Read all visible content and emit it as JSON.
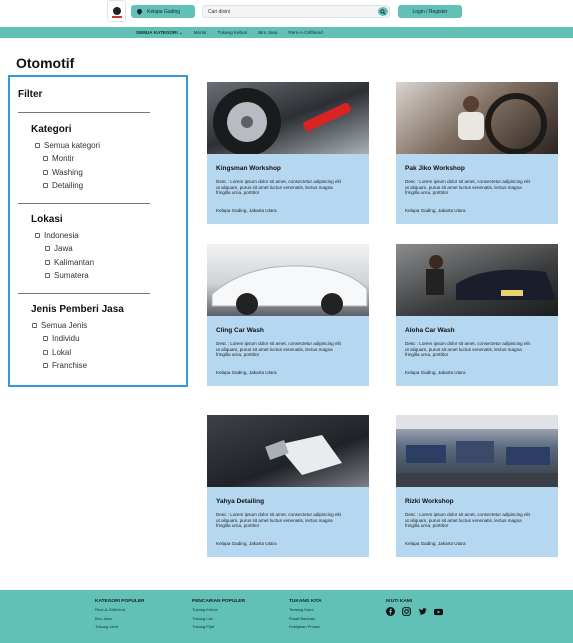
{
  "header": {
    "location_label": "Kelapa Gading",
    "search_placeholder": "Cari disini",
    "login_label": "Login / Register"
  },
  "nav": {
    "items": [
      "SEMUA KATEGORI ⌄",
      "Montir",
      "Tukang Kebun",
      "Biro Jasa",
      "Rent-A-Girlfriend"
    ]
  },
  "page": {
    "title": "Otomotif"
  },
  "filter": {
    "title": "Filter",
    "kategori": {
      "heading": "Kategori",
      "options": [
        "Semua kategori",
        "Montir",
        "Washing",
        "Detailing"
      ]
    },
    "lokasi": {
      "heading": "Lokasi",
      "options": [
        "Indonesia",
        "Jawa",
        "Kalimantan",
        "Sumatera"
      ]
    },
    "jenis": {
      "heading": "Jenis Pemberi Jasa",
      "options": [
        "Semua Jenis",
        "Individu",
        "Lokal",
        "Franchise"
      ]
    }
  },
  "cards": [
    {
      "name": "Kingsman Workshop",
      "desc": "Desc : Lorem ipsum dolor sit amet, consectetur adipiscing elit ut aliquam, purus sit amet luctus venenatis, lectus magna fringilla urna, porttitor",
      "location": "Kelapa Gading, Jakarta Utara"
    },
    {
      "name": "Pak Jiko Workshop",
      "desc": "Desc : Lorem ipsum dolor sit amet, consectetur adipiscing elit ut aliquam, purus sit amet luctus venenatis, lectus magna fringilla urna, porttitor",
      "location": "Kelapa Gading, Jakarta Utara"
    },
    {
      "name": "Cling Car Wash",
      "desc": "Desc : Lorem ipsum dolor sit amet, consectetur adipiscing elit ut aliquam, purus sit amet luctus venenatis, lectus magna fringilla urna, porttitor",
      "location": "Kelapa Gading, Jakarta Utara"
    },
    {
      "name": "Aloha Car Wash",
      "desc": "Desc : Lorem ipsum dolor sit amet, consectetur adipiscing elit ut aliquam, purus sit amet luctus venenatis, lectus magna fringilla urna, porttitor",
      "location": "Kelapa Gading, Jakarta Utara"
    },
    {
      "name": "Yahya Detailing",
      "desc": "Desc : Lorem ipsum dolor sit amet, consectetur adipiscing elit ut aliquam, purus sit amet luctus venenatis, lectus magna fringilla urna, porttitor",
      "location": "Kelapa Gading, Jakarta Utara"
    },
    {
      "name": "Rizki Workshop",
      "desc": "Desc : Lorem ipsum dolor sit amet, consectetur adipiscing elit ut aliquam, purus sit amet luctus venenatis, lectus magna fringilla urna, porttitor",
      "location": "Kelapa Gading, Jakarta Utara"
    }
  ],
  "footer": {
    "kategori_populer": {
      "heading": "KATEGORI POPULER",
      "items": [
        "Rent-A-Girlfriend",
        "Biro Jasa",
        "Tukang Jahit"
      ]
    },
    "pencarian_populer": {
      "heading": "PENCARIAN POPULER",
      "items": [
        "Tukang Kebun",
        "Tukang Las",
        "Tukang Pijat"
      ]
    },
    "tukang_kita": {
      "heading": "TUKANG KITA",
      "items": [
        "Tentang Kami",
        "Pusat Bantuan",
        "Kebijakan Privasi"
      ]
    },
    "ikuti_kami": {
      "heading": "IKUTI KAMI",
      "icons": [
        "facebook-icon",
        "instagram-icon",
        "twitter-icon",
        "youtube-icon"
      ]
    }
  },
  "colors": {
    "accent": "#62c1b6",
    "card": "#b5d7f0",
    "filter_border": "#3498db"
  }
}
